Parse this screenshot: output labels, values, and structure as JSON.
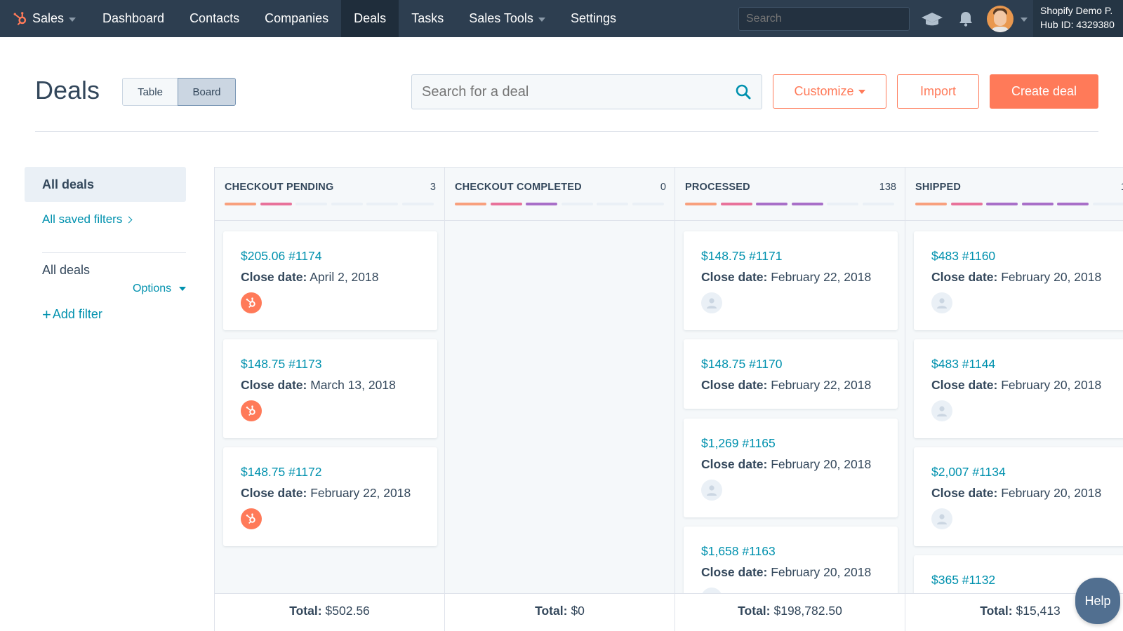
{
  "topnav": {
    "brand": "Sales",
    "items": [
      "Dashboard",
      "Contacts",
      "Companies",
      "Deals",
      "Tasks",
      "Sales Tools",
      "Settings"
    ],
    "active": "Deals",
    "search_placeholder": "Search",
    "account_name": "Shopify Demo P.",
    "hub_id": "Hub ID: 4329380"
  },
  "header": {
    "title": "Deals",
    "view_table": "Table",
    "view_board": "Board",
    "active_view": "Board",
    "search_placeholder": "Search for a deal",
    "customize": "Customize",
    "import": "Import",
    "create": "Create deal"
  },
  "sidebar": {
    "all_deals": "All deals",
    "saved_filters": "All saved filters",
    "list_title": "All deals",
    "options": "Options",
    "add_filter": "Add filter"
  },
  "colors": {
    "accent": "#ff7a59",
    "link": "#0091ae",
    "nav_bg": "#2d3e50",
    "stage_colors": [
      "#f8a07d",
      "#e8729a",
      "#a86fc8",
      "#a86fc8",
      "#a86fc8"
    ]
  },
  "board": {
    "columns": [
      {
        "title": "CHECKOUT PENDING",
        "count": "3",
        "filled_segments": 2,
        "total_label": "Total:",
        "total": "$502.56",
        "cards": [
          {
            "amount": "$205.06 #1174",
            "date_label": "Close date:",
            "date": "April 2, 2018",
            "badge": "hubspot-icon"
          },
          {
            "amount": "$148.75 #1173",
            "date_label": "Close date:",
            "date": "March 13, 2018",
            "badge": "hubspot-icon"
          },
          {
            "amount": "$148.75 #1172",
            "date_label": "Close date:",
            "date": "February 22, 2018",
            "badge": "hubspot-icon"
          }
        ]
      },
      {
        "title": "CHECKOUT COMPLETED",
        "count": "0",
        "filled_segments": 3,
        "total_label": "Total:",
        "total": "$0",
        "cards": []
      },
      {
        "title": "PROCESSED",
        "count": "138",
        "filled_segments": 4,
        "total_label": "Total:",
        "total": "$198,782.50",
        "cards": [
          {
            "amount": "$148.75 #1171",
            "date_label": "Close date:",
            "date": "February 22, 2018",
            "badge": "person-icon"
          },
          {
            "amount": "$148.75 #1170",
            "date_label": "Close date:",
            "date": "February 22, 2018",
            "badge": ""
          },
          {
            "amount": "$1,269 #1165",
            "date_label": "Close date:",
            "date": "February 20, 2018",
            "badge": "person-icon"
          },
          {
            "amount": "$1,658 #1163",
            "date_label": "Close date:",
            "date": "February 20, 2018",
            "badge": "person-icon"
          }
        ]
      },
      {
        "title": "SHIPPED",
        "count": "1",
        "filled_segments": 5,
        "total_label": "Total:",
        "total": "$15,413",
        "cards": [
          {
            "amount": "$483 #1160",
            "date_label": "Close date:",
            "date": "February 20, 2018",
            "badge": "person-icon"
          },
          {
            "amount": "$483 #1144",
            "date_label": "Close date:",
            "date": "February 20, 2018",
            "badge": "person-icon"
          },
          {
            "amount": "$2,007 #1134",
            "date_label": "Close date:",
            "date": "February 20, 2018",
            "badge": "person-icon"
          },
          {
            "amount": "$365 #1132",
            "date_label": "",
            "date": "",
            "badge": ""
          }
        ]
      }
    ]
  },
  "help": "Help"
}
